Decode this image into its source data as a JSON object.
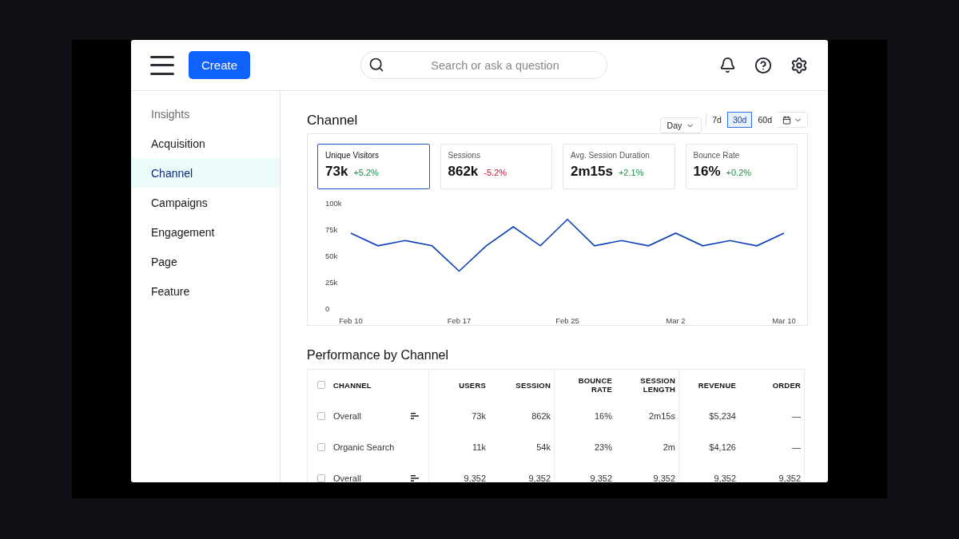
{
  "header": {
    "create_button": "Create",
    "search": {
      "placeholder": "Search or ask a question"
    }
  },
  "sidebar": {
    "heading": "Insights",
    "items": [
      {
        "label": "Acquisition",
        "selected": false
      },
      {
        "label": "Channel",
        "selected": true
      },
      {
        "label": "Campaigns",
        "selected": false
      },
      {
        "label": "Engagement",
        "selected": false
      },
      {
        "label": "Page",
        "selected": false
      },
      {
        "label": "Feature",
        "selected": false
      }
    ]
  },
  "channel": {
    "title": "Channel",
    "interval": "Day",
    "ranges": [
      {
        "label": "7d",
        "selected": false
      },
      {
        "label": "30d",
        "selected": true
      },
      {
        "label": "60d",
        "selected": false
      }
    ],
    "metrics": [
      {
        "label": "Unique Visitors",
        "value": "73k",
        "change": "+5.2%",
        "positive": true,
        "selected": true
      },
      {
        "label": "Sessions",
        "value": "862k",
        "change": "-5.2%",
        "positive": false,
        "selected": false
      },
      {
        "label": "Avg. Session Duration",
        "value": "2m15s",
        "change": "+2.1%",
        "positive": true,
        "selected": false
      },
      {
        "label": "Bounce Rate",
        "value": "16%",
        "change": "+0.2%",
        "positive": true,
        "selected": false
      }
    ],
    "chart_data": {
      "type": "line",
      "categories": [
        "Feb 10",
        null,
        null,
        null,
        "Feb 17",
        null,
        null,
        null,
        "Feb 25",
        null,
        null,
        null,
        "Mar 2",
        null,
        null,
        null,
        "Mar 10"
      ],
      "series": [
        {
          "color": "#0b3fb8",
          "values": [
            72000,
            60000,
            65000,
            60000,
            36000,
            60000,
            78000,
            60000,
            85000,
            60000,
            65000,
            60000,
            72000,
            60000,
            65000,
            60000,
            72000
          ]
        }
      ],
      "ylim": [
        0,
        100000
      ],
      "yticks": [
        {
          "value": 0,
          "label": "0"
        },
        {
          "value": 25000,
          "label": "25k"
        },
        {
          "value": 50000,
          "label": "50k"
        },
        {
          "value": 75000,
          "label": "75k"
        },
        {
          "value": 100000,
          "label": "100k"
        }
      ]
    }
  },
  "performance": {
    "title": "Performance by Channel",
    "header_checked": false,
    "columns": [
      "CHANNEL",
      "USERS",
      "SESSION",
      "BOUNCE RATE",
      "SESSION LENGTH",
      "REVENUE",
      "ORDER"
    ],
    "rows": [
      {
        "checked": false,
        "sortable": true,
        "cells": [
          "Overall",
          "73k",
          "862k",
          "16%",
          "2m15s",
          "$5,234",
          "—"
        ]
      },
      {
        "checked": false,
        "sortable": false,
        "cells": [
          "Organic Search",
          "11k",
          "54k",
          "23%",
          "2m",
          "$4,126",
          "—"
        ]
      },
      {
        "checked": false,
        "sortable": true,
        "cells": [
          "Overall",
          "9,352",
          "9,352",
          "9,352",
          "9,352",
          "9,352",
          "9,352"
        ]
      }
    ]
  }
}
